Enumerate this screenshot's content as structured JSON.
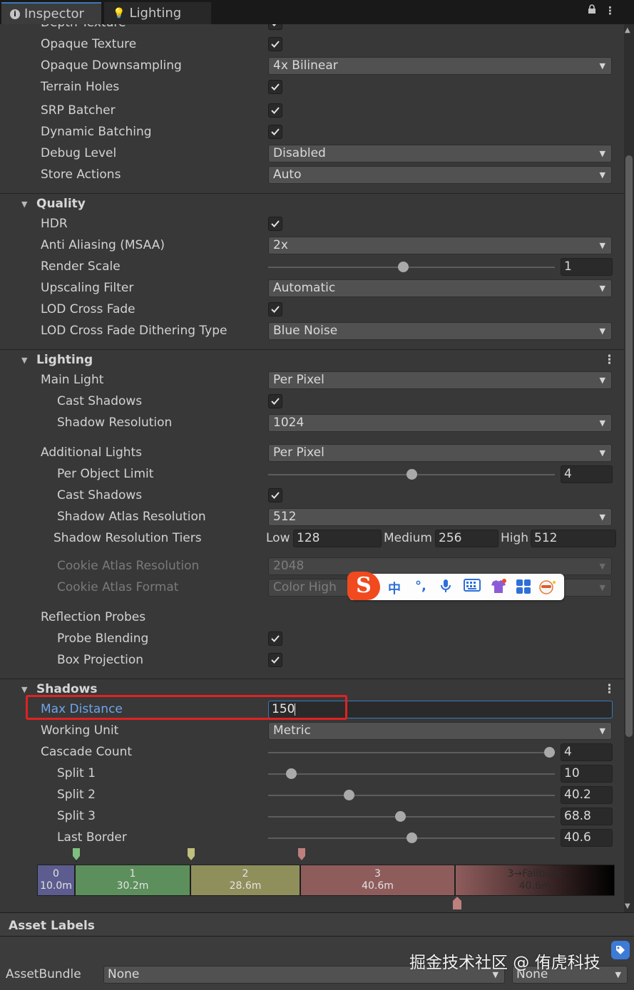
{
  "tabs": {
    "inspector": "Inspector",
    "lighting": "Lighting"
  },
  "rendering": {
    "depth_texture": "Depth Texture",
    "opaque_texture": "Opaque Texture",
    "opaque_downsampling": {
      "label": "Opaque Downsampling",
      "value": "4x Bilinear"
    },
    "terrain_holes": "Terrain Holes",
    "srp_batcher": "SRP Batcher",
    "dynamic_batching": "Dynamic Batching",
    "debug_level": {
      "label": "Debug Level",
      "value": "Disabled"
    },
    "store_actions": {
      "label": "Store Actions",
      "value": "Auto"
    }
  },
  "quality": {
    "title": "Quality",
    "hdr": "HDR",
    "msaa": {
      "label": "Anti Aliasing (MSAA)",
      "value": "2x"
    },
    "render_scale": {
      "label": "Render Scale",
      "value": "1",
      "fraction": 0.47
    },
    "upscaling": {
      "label": "Upscaling Filter",
      "value": "Automatic"
    },
    "lod_cross_fade": "LOD Cross Fade",
    "lod_dither": {
      "label": "LOD Cross Fade Dithering Type",
      "value": "Blue Noise"
    }
  },
  "lighting": {
    "title": "Lighting",
    "main_light": {
      "label": "Main Light",
      "value": "Per Pixel"
    },
    "cast_shadows": "Cast Shadows",
    "shadow_resolution": {
      "label": "Shadow Resolution",
      "value": "1024"
    },
    "additional_lights": {
      "label": "Additional Lights",
      "value": "Per Pixel"
    },
    "per_object_limit": {
      "label": "Per Object Limit",
      "value": "4",
      "fraction": 0.5
    },
    "add_cast_shadows": "Cast Shadows",
    "shadow_atlas": {
      "label": "Shadow Atlas Resolution",
      "value": "512"
    },
    "tiers": {
      "label": "Shadow Resolution Tiers",
      "low_label": "Low",
      "low": "128",
      "medium_label": "Medium",
      "medium": "256",
      "high_label": "High",
      "high": "512"
    },
    "cookie_atlas_res": {
      "label": "Cookie Atlas Resolution",
      "value": "2048"
    },
    "cookie_atlas_format": {
      "label": "Cookie Atlas Format",
      "value": "Color High"
    },
    "reflection_probes": "Reflection Probes",
    "probe_blending": "Probe Blending",
    "box_projection": "Box Projection"
  },
  "shadows": {
    "title": "Shadows",
    "max_distance": {
      "label": "Max Distance",
      "value": "150"
    },
    "working_unit": {
      "label": "Working Unit",
      "value": "Metric"
    },
    "cascade_count": {
      "label": "Cascade Count",
      "value": "4",
      "fraction": 0.98
    },
    "split1": {
      "label": "Split 1",
      "value": "10",
      "fraction": 0.08
    },
    "split2": {
      "label": "Split 2",
      "value": "40.2",
      "fraction": 0.28
    },
    "split3": {
      "label": "Split 3",
      "value": "68.8",
      "fraction": 0.46
    },
    "last_border": {
      "label": "Last Border",
      "value": "40.6",
      "fraction": 0.5
    },
    "cascades": [
      {
        "index": "0",
        "dist": "10.0m",
        "color": "#5c5c8f"
      },
      {
        "index": "1",
        "dist": "30.2m",
        "color": "#5c8f5c"
      },
      {
        "index": "2",
        "dist": "28.6m",
        "color": "#8f8f5c"
      },
      {
        "index": "3",
        "dist": "40.6m",
        "color": "#8f5c5c"
      },
      {
        "index": "3→Fallback",
        "dist": "40.6m",
        "color": "#8f5c5c"
      }
    ]
  },
  "ime": {
    "logo": "S",
    "chinese": "中"
  },
  "asset_labels": {
    "title": "Asset Labels",
    "bundle_label": "AssetBundle",
    "bundle_value": "None",
    "variant_value": "None"
  },
  "watermark": "掘金技术社区 @ 侑虎科技",
  "colors": {
    "accent": "#3a79bb",
    "highlight": "#e02222",
    "ime_logo": "#f04a1e"
  }
}
